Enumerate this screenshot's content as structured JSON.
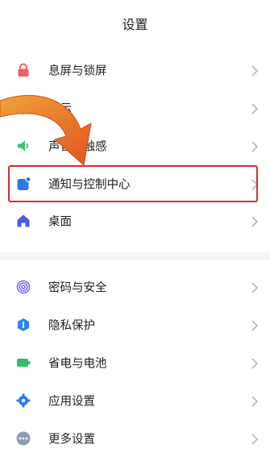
{
  "header": {
    "title": "设置"
  },
  "items_top": [
    {
      "label": "息屏与锁屏",
      "icon": "lock-icon"
    },
    {
      "label": "显示",
      "icon": "sun-icon"
    },
    {
      "label": "声音与触感",
      "icon": "speaker-icon"
    },
    {
      "label": "通知与控制中心",
      "icon": "notification-icon",
      "highlighted": true
    },
    {
      "label": "桌面",
      "icon": "home-icon"
    }
  ],
  "items_bottom": [
    {
      "label": "密码与安全",
      "icon": "fingerprint-icon"
    },
    {
      "label": "隐私保护",
      "icon": "privacy-icon"
    },
    {
      "label": "省电与电池",
      "icon": "battery-icon"
    },
    {
      "label": "应用设置",
      "icon": "gear-icon"
    },
    {
      "label": "更多设置",
      "icon": "more-icon"
    }
  ],
  "colors": {
    "highlight_border": "#d0312d",
    "arrow": "#e8812b",
    "chevron": "#b8b8b8"
  }
}
